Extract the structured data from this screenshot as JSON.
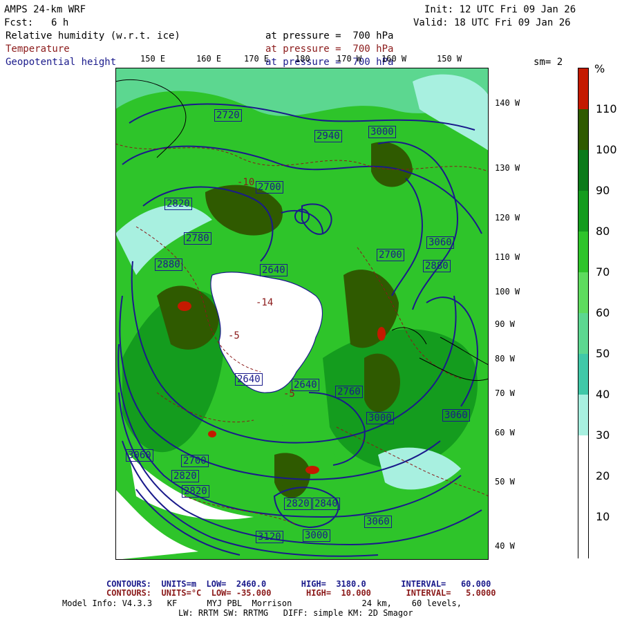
{
  "header": {
    "model": "AMPS 24-km WRF",
    "init": "Init: 12 UTC Fri 09 Jan 26",
    "fcst_label": "Fcst:",
    "fcst_value": "6 h",
    "valid": "Valid: 18 UTC Fri 09 Jan 26",
    "smoothing": "sm= 2"
  },
  "fields": [
    {
      "name": "Relative humidity (w.r.t. ice)",
      "level": "at pressure =  700 hPa",
      "color": "#000000"
    },
    {
      "name": "Temperature",
      "level": "at pressure =  700 hPa",
      "color": "#8b1a1a"
    },
    {
      "name": "Geopotential height",
      "level": "at pressure =  700 hPa",
      "color": "#1a1a8b"
    }
  ],
  "longitude_labels_top": [
    "150 E",
    "160 E",
    "170 E",
    "180",
    "170 W",
    "160 W",
    "150 W"
  ],
  "latitude_labels_right": [
    "140 W",
    "130 W",
    "120 W",
    "110 W",
    "100 W",
    "90 W",
    "80 W",
    "70 W",
    "60 W",
    "50 W",
    "40 W"
  ],
  "contour_labels": [
    "2720",
    "2940",
    "3000",
    "2700",
    "2820",
    "2780",
    "2880",
    "2880",
    "3060",
    "2640",
    "2700",
    "2640",
    "2640",
    "2760",
    "2820",
    "3000",
    "3060",
    "2700",
    "2820",
    "2840",
    "2820",
    "3000",
    "3060",
    "3120",
    "3060"
  ],
  "temperature_labels": [
    "-14",
    "-10",
    "-5",
    "-5"
  ],
  "colorbar": {
    "unit": "%",
    "ticks": [
      "110",
      "100",
      "90",
      "80",
      "70",
      "60",
      "50",
      "40",
      "30",
      "20",
      "10"
    ],
    "colors_top_to_bottom": [
      "#c41a00",
      "#2f5a00",
      "#0b7a1a",
      "#149c1e",
      "#2ec42a",
      "#5edb5e",
      "#5cd790",
      "#40c8a8",
      "#a8f0e0",
      "#ffffff",
      "#ffffff",
      "#ffffff"
    ]
  },
  "footer": {
    "contours_height": "CONTOURS:  UNITS=m  LOW=  2460.0       HIGH=  3180.0       INTERVAL=   60.000",
    "contours_temp": "CONTOURS:  UNITS=°C  LOW= -35.000       HIGH=  10.000       INTERVAL=   5.0000",
    "model_info_1": "Model Info: V4.3.3   KF      MYJ PBL  Morrison              24 km,    60 levels,",
    "model_info_2": "LW: RRTM SW: RRTMG   DIFF: simple KM: 2D Smagor"
  }
}
